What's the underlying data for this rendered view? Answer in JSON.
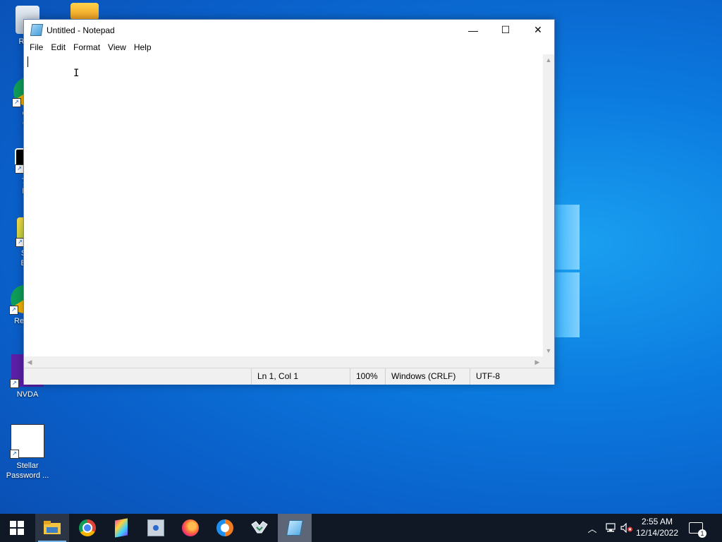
{
  "desktop": {
    "icons": [
      {
        "label": "Recy",
        "name": "recycle-bin"
      },
      {
        "label": "Go Ch",
        "name": "google-chrome"
      },
      {
        "label": "7-Z Ma",
        "name": "7zip"
      },
      {
        "label": "Sys Exa",
        "name": "system-explorer"
      },
      {
        "label": "Repor",
        "name": "report"
      },
      {
        "label": "NVDA",
        "name": "nvda"
      },
      {
        "label": "Stellar Password ...",
        "name": "stellar-password"
      }
    ]
  },
  "window": {
    "title": "Untitled - Notepad",
    "controls": {
      "minimize": "—",
      "maximize": "☐",
      "close": "✕"
    },
    "menu": [
      "File",
      "Edit",
      "Format",
      "View",
      "Help"
    ],
    "content": "",
    "status": {
      "position": "Ln 1, Col 1",
      "zoom": "100%",
      "line_ending": "Windows (CRLF)",
      "encoding": "UTF-8"
    }
  },
  "taskbar": {
    "time": "2:55 AM",
    "date": "12/14/2022",
    "notification_count": "1",
    "apps": [
      "start",
      "file-explorer",
      "chrome",
      "app-colorful",
      "app-security",
      "firefox",
      "app-vpn",
      "app-handshake",
      "notepad"
    ]
  },
  "colors": {
    "desktop": "#0a5fc9",
    "taskbar": "#101826",
    "accent": "#76b9ed"
  }
}
